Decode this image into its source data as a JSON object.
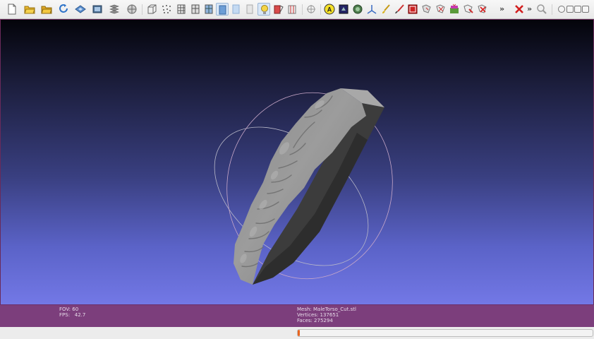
{
  "toolbar": {
    "icons": [
      "new-file-icon",
      "open-folder-icon",
      "open-project-icon",
      "reload-icon",
      "save-icon",
      "snapshot-icon",
      "layers-icon",
      "render-mode-icon",
      "bounding-box-icon",
      "points-icon",
      "wireframe-icon",
      "hidden-lines-icon",
      "flat-lines-icon",
      "flat-icon",
      "smooth-icon",
      "light-icon",
      "face-culling-icon",
      "texture-icon",
      "trackball-icon",
      "annotation-icon",
      "decorate-icon",
      "color-pick-icon",
      "axis-icon",
      "paint-icon",
      "brush-icon",
      "select-faces-icon",
      "select-vertices-icon",
      "select-connected-icon",
      "zoom-selection-icon",
      "delete-selection-icon",
      "more-icon",
      "close-icon",
      "search-icon"
    ]
  },
  "viewport": {
    "fov_label": "FOV:",
    "fov_value": "60",
    "fps_label": "FPS:",
    "fps_value": "42.7"
  },
  "mesh_info": {
    "mesh": "Mesh: MaleTorso_Cut.stl",
    "vertices": "Vertices: 137651",
    "faces": "Faces: 275294"
  },
  "progress": {
    "fraction": 0.006
  },
  "colors": {
    "accent_bar": "#7c3e7c",
    "progress_fill": "#e8641e"
  }
}
